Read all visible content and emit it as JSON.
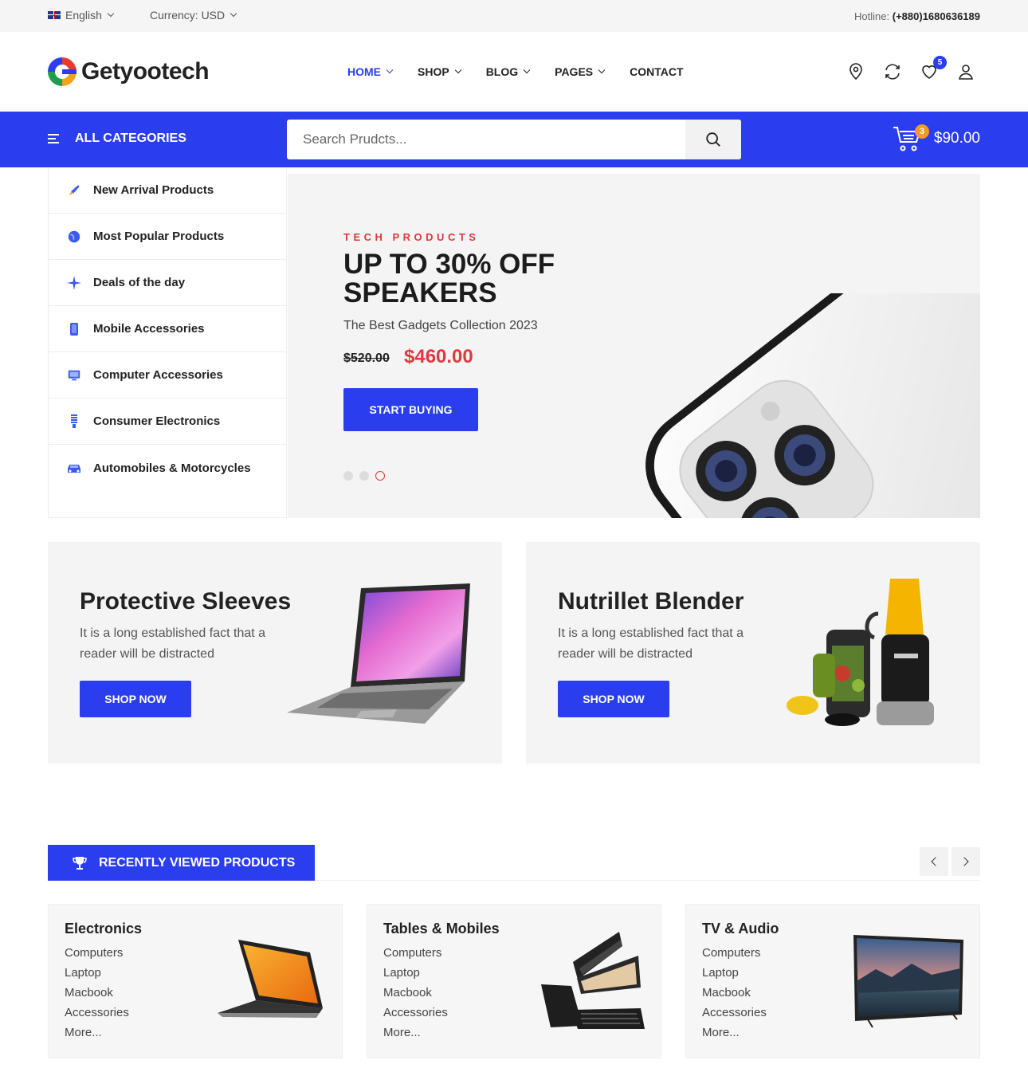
{
  "topbar": {
    "language": "English",
    "currency": "Currency: USD",
    "hotline_label": "Hotline:",
    "hotline_number": "(+880)1680636189"
  },
  "header": {
    "logo_text": "Getyootech",
    "nav": [
      {
        "label": "HOME",
        "dropdown": true,
        "active": true
      },
      {
        "label": "SHOP",
        "dropdown": true
      },
      {
        "label": "BLOG",
        "dropdown": true
      },
      {
        "label": "PAGES",
        "dropdown": true
      },
      {
        "label": "CONTACT",
        "dropdown": false
      }
    ],
    "wishlist_count": "5"
  },
  "bluebar": {
    "all_categories": "ALL CATEGORIES",
    "search_placeholder": "Search Prudcts...",
    "cart_count": "3",
    "cart_total": "$90.00"
  },
  "categories": [
    {
      "label": "New Arrival Products",
      "icon": "rocket-icon"
    },
    {
      "label": "Most Popular Products",
      "icon": "globe-icon"
    },
    {
      "label": "Deals of the day",
      "icon": "sparkle-icon"
    },
    {
      "label": "Mobile Accessories",
      "icon": "mobile-icon"
    },
    {
      "label": "Computer Accessories",
      "icon": "monitor-icon"
    },
    {
      "label": "Consumer Electronics",
      "icon": "bulb-icon"
    },
    {
      "label": "Automobiles & Motorcycles",
      "icon": "car-icon"
    }
  ],
  "hero": {
    "tag": "TECH PRODUCTS",
    "headline": "UP TO 30% OFF SPEAKERS",
    "subtitle": "The Best Gadgets Collection 2023",
    "old_price": "$520.00",
    "new_price": "$460.00",
    "button": "START BUYING",
    "slides": 3,
    "active_slide": 3
  },
  "promos": [
    {
      "title": "Protective Sleeves",
      "desc": "It is a long established fact that a reader will be distracted",
      "button": "SHOP NOW"
    },
    {
      "title": "Nutrillet Blender",
      "desc": "It is a long established fact that a reader will be distracted",
      "button": "SHOP NOW"
    }
  ],
  "recently_viewed": {
    "title": "RECENTLY VIEWED PRODUCTS",
    "cards": [
      {
        "title": "Electronics",
        "links": [
          "Computers",
          "Laptop",
          "Macbook",
          "Accessories",
          "More..."
        ]
      },
      {
        "title": "Tables & Mobiles",
        "links": [
          "Computers",
          "Laptop",
          "Macbook",
          "Accessories",
          "More..."
        ]
      },
      {
        "title": "TV & Audio",
        "links": [
          "Computers",
          "Laptop",
          "Macbook",
          "Accessories",
          "More..."
        ]
      }
    ]
  },
  "colors": {
    "primary": "#2a3ef0",
    "accent_red": "#e0383e",
    "cart_badge": "#f29b1d"
  }
}
